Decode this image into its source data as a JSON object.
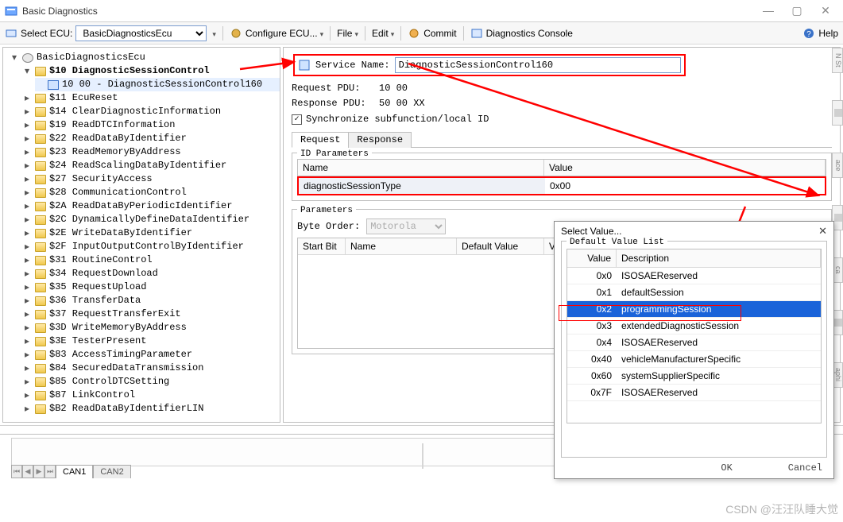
{
  "window": {
    "title": "Basic Diagnostics"
  },
  "toolbar": {
    "select_ecu_label": "Select ECU:",
    "ecu_value": "BasicDiagnosticsEcu",
    "configure": "Configure ECU...",
    "file": "File",
    "edit": "Edit",
    "commit": "Commit",
    "console": "Diagnostics Console",
    "help": "Help"
  },
  "tree": {
    "root": "BasicDiagnosticsEcu",
    "services": [
      {
        "id": "$10",
        "label": "$10 DiagnosticSessionControl",
        "expanded": true,
        "bold": true,
        "children": [
          {
            "id": "1000",
            "label": "10 00 - DiagnosticSessionControl160",
            "sel": true
          }
        ]
      },
      {
        "id": "$11",
        "label": "$11 EcuReset"
      },
      {
        "id": "$14",
        "label": "$14 ClearDiagnosticInformation"
      },
      {
        "id": "$19",
        "label": "$19 ReadDTCInformation"
      },
      {
        "id": "$22",
        "label": "$22 ReadDataByIdentifier"
      },
      {
        "id": "$23",
        "label": "$23 ReadMemoryByAddress"
      },
      {
        "id": "$24",
        "label": "$24 ReadScalingDataByIdentifier"
      },
      {
        "id": "$27",
        "label": "$27 SecurityAccess"
      },
      {
        "id": "$28",
        "label": "$28 CommunicationControl"
      },
      {
        "id": "$2A",
        "label": "$2A ReadDataByPeriodicIdentifier"
      },
      {
        "id": "$2C",
        "label": "$2C DynamicallyDefineDataIdentifier"
      },
      {
        "id": "$2E",
        "label": "$2E WriteDataByIdentifier"
      },
      {
        "id": "$2F",
        "label": "$2F InputOutputControlByIdentifier"
      },
      {
        "id": "$31",
        "label": "$31 RoutineControl"
      },
      {
        "id": "$34",
        "label": "$34 RequestDownload"
      },
      {
        "id": "$35",
        "label": "$35 RequestUpload"
      },
      {
        "id": "$36",
        "label": "$36 TransferData"
      },
      {
        "id": "$37",
        "label": "$37 RequestTransferExit"
      },
      {
        "id": "$3D",
        "label": "$3D WriteMemoryByAddress"
      },
      {
        "id": "$3E",
        "label": "$3E TesterPresent"
      },
      {
        "id": "$83",
        "label": "$83 AccessTimingParameter"
      },
      {
        "id": "$84",
        "label": "$84 SecuredDataTransmission"
      },
      {
        "id": "$85",
        "label": "$85 ControlDTCSetting"
      },
      {
        "id": "$87",
        "label": "$87 LinkControl"
      },
      {
        "id": "$B2",
        "label": "$B2 ReadDataByIdentifierLIN"
      }
    ]
  },
  "detail": {
    "service_name_label": "Service Name:",
    "service_name_value": "DiagnosticSessionControl160",
    "request_pdu_label": "Request PDU:",
    "request_pdu_value": "10 00",
    "response_pdu_label": "Response PDU:",
    "response_pdu_value": "50 00 XX",
    "sync_label": "Synchronize subfunction/local ID",
    "tabs": {
      "request": "Request",
      "response": "Response"
    },
    "idparams_legend": "ID Parameters",
    "idparams_cols": {
      "name": "Name",
      "value": "Value"
    },
    "idparams_row": {
      "name": "diagnosticSessionType",
      "value": "0x00"
    },
    "params_legend": "Parameters",
    "byte_order_label": "Byte Order:",
    "byte_order_value": "Motorola",
    "params_cols": [
      "Start Bit",
      "Name",
      "Default Value",
      "V"
    ]
  },
  "popup": {
    "title": "Select Value...",
    "legend": "Default Value List",
    "cols": {
      "value": "Value",
      "desc": "Description"
    },
    "rows": [
      {
        "v": "0x0",
        "d": "ISOSAEReserved"
      },
      {
        "v": "0x1",
        "d": "defaultSession"
      },
      {
        "v": "0x2",
        "d": "programmingSession",
        "sel": true
      },
      {
        "v": "0x3",
        "d": "extendedDiagnosticSession"
      },
      {
        "v": "0x4",
        "d": "ISOSAEReserved"
      },
      {
        "v": "0x40",
        "d": "vehicleManufacturerSpecific"
      },
      {
        "v": "0x60",
        "d": "systemSupplierSpecific"
      },
      {
        "v": "0x7F",
        "d": "ISOSAEReserved"
      }
    ],
    "ok": "OK",
    "cancel": "Cancel"
  },
  "bottom": {
    "tabs": [
      "CAN1",
      "CAN2"
    ]
  },
  "ghost_tabs": [
    "N St",
    "",
    "ace",
    "",
    "ca",
    "",
    "aphi"
  ],
  "watermark": "CSDN @汪汪队睡大觉"
}
